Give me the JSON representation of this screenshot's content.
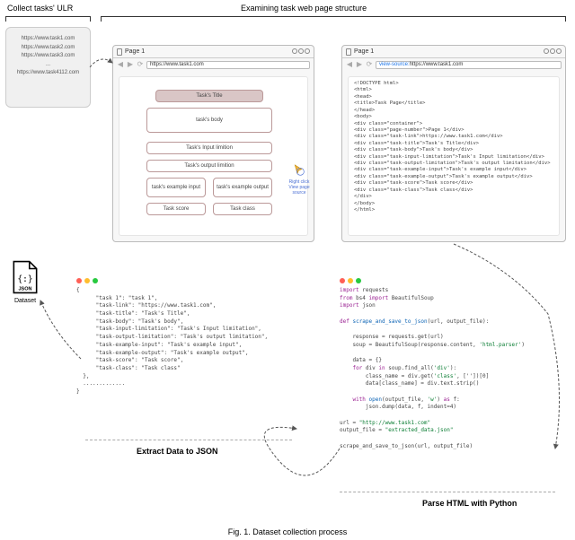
{
  "labels": {
    "collect": "Collect tasks' ULR",
    "examine": "Examining task web page structure",
    "extract": "Extract Data to JSON",
    "parse": "Parse HTML with Python",
    "caption": "Fig. 1. Dataset collection process",
    "dataset": "Dataset"
  },
  "url_list": {
    "items": [
      "https://www.task1.com",
      "https://www.task2.com",
      "https://www.task3.com",
      "...",
      "https://www.task4112.com"
    ]
  },
  "browser_left": {
    "tab": "Page 1",
    "url": "https://www.task1.com",
    "chips": [
      "Task's Title",
      "task's body",
      "Task's Input limition",
      "Task's output limition",
      "task's example input",
      "task's example output",
      "Task score",
      "Task class"
    ]
  },
  "click": {
    "l1": "Right click",
    "l2": "View page source"
  },
  "browser_right": {
    "tab": "Page 1",
    "prefix": "view-source:",
    "url": "https://www.task1.com",
    "html_lines": [
      "<!DOCTYPE html>",
      "<html>",
      "<head>",
      "<title>Task Page</title>",
      "</head>",
      "<body>",
      "<div class=\"container\">",
      "<div class=\"page-number\">Page 1</div>",
      "<div class=\"task-link\">https://www.task1.com</div>",
      "<div class=\"task-title\">Task's Title</div>",
      "<div class=\"task-body\">Task's body</div>",
      "<div class=\"task-input-limitation\">Task's Input limitation</div>",
      "<div class=\"task-output-limitation\">Task's output limitation</div>",
      "<div class=\"task-example-input\">Task's example input</div>",
      "<div class=\"task-example-output\">Task's example output</div>",
      "<div class=\"task-score\">Task score</div>",
      "<div class=\"task-class\">Task class</div>",
      "</div>",
      "</body>",
      "</html>"
    ]
  },
  "json_code": {
    "open": "{",
    "lines": [
      "    \"task 1\": \"task 1\",",
      "    \"task-link\": \"https://www.task1.com\",",
      "    \"task-title\": \"Task's Title\",",
      "    \"task-body\": \"Task's body\",",
      "    \"task-input-limitation\": \"Task's Input limitation\",",
      "    \"task-output-limitation\": \"Task's output limitation\",",
      "    \"task-example-input\": \"Task's example input\",",
      "    \"task-example-output\": \"Task's example output\",",
      "    \"task-score\": \"Task score\",",
      "    \"task-class\": \"Task class\""
    ],
    "mid": "},",
    "after": ".............",
    "close": "}"
  },
  "py_code": [
    {
      "t": "kw",
      "v": "import"
    },
    {
      "t": "",
      "v": " requests\n"
    },
    {
      "t": "kw",
      "v": "from"
    },
    {
      "t": "",
      "v": " bs4 "
    },
    {
      "t": "kw",
      "v": "import"
    },
    {
      "t": "",
      "v": " BeautifulSoup\n"
    },
    {
      "t": "kw",
      "v": "import"
    },
    {
      "t": "",
      "v": " json\n\n"
    },
    {
      "t": "kw",
      "v": "def"
    },
    {
      "t": "",
      "v": " "
    },
    {
      "t": "fn",
      "v": "scrape_and_save_to_json"
    },
    {
      "t": "",
      "v": "(url, output_file):\n\n"
    },
    {
      "t": "",
      "v": "    response = requests.get(url)\n"
    },
    {
      "t": "",
      "v": "    soup = BeautifulSoup(response.content, "
    },
    {
      "t": "str",
      "v": "'html.parser'"
    },
    {
      "t": "",
      "v": ")\n\n"
    },
    {
      "t": "",
      "v": "    data = {}\n"
    },
    {
      "t": "",
      "v": "    "
    },
    {
      "t": "kw",
      "v": "for"
    },
    {
      "t": "",
      "v": " div "
    },
    {
      "t": "kw",
      "v": "in"
    },
    {
      "t": "",
      "v": " soup.find_all("
    },
    {
      "t": "str",
      "v": "'div'"
    },
    {
      "t": "",
      "v": "):\n"
    },
    {
      "t": "",
      "v": "        class_name = div.get("
    },
    {
      "t": "str",
      "v": "'class'"
    },
    {
      "t": "",
      "v": ", [''])[0]\n"
    },
    {
      "t": "",
      "v": "        data[class_name] = div.text.strip()\n\n"
    },
    {
      "t": "",
      "v": "    "
    },
    {
      "t": "kw",
      "v": "with"
    },
    {
      "t": "",
      "v": " "
    },
    {
      "t": "fn",
      "v": "open"
    },
    {
      "t": "",
      "v": "(output_file, "
    },
    {
      "t": "str",
      "v": "'w'"
    },
    {
      "t": "",
      "v": ") "
    },
    {
      "t": "kw",
      "v": "as"
    },
    {
      "t": "",
      "v": " f:\n"
    },
    {
      "t": "",
      "v": "        json.dump(data, f, indent=4)\n\n"
    },
    {
      "t": "",
      "v": "url = "
    },
    {
      "t": "str",
      "v": "\"http://www.task1.com\""
    },
    {
      "t": "",
      "v": "\n"
    },
    {
      "t": "",
      "v": "output_file = "
    },
    {
      "t": "str",
      "v": "\"extracted_data.json\""
    },
    {
      "t": "",
      "v": "\n\n"
    },
    {
      "t": "",
      "v": "scrape_and_save_to_json(url, output_file)\n"
    }
  ]
}
